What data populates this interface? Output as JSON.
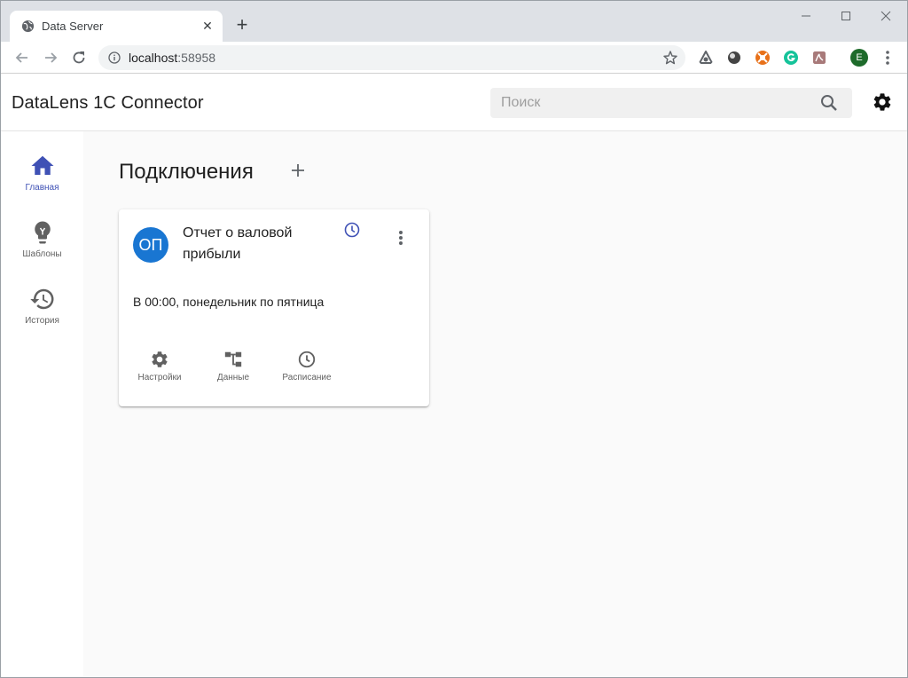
{
  "browser": {
    "tab_title": "Data Server",
    "url_host": "localhost",
    "url_port": ":58958",
    "profile_initial": "E",
    "extensions": [
      {
        "name": "dolphin-ext-icon",
        "color": "#5f6368"
      },
      {
        "name": "circle-ext-icon",
        "color": "#444444"
      },
      {
        "name": "lifesaver-ext-icon",
        "color": "#e8711a"
      },
      {
        "name": "grammarly-ext-icon",
        "color": "#15c39a"
      },
      {
        "name": "pdf-ext-icon",
        "color": "#9e6a6a"
      }
    ]
  },
  "appbar": {
    "title": "DataLens 1C Connector",
    "search_placeholder": "Поиск"
  },
  "sidebar": {
    "items": [
      {
        "label": "Главная",
        "icon": "home-icon"
      },
      {
        "label": "Шаблоны",
        "icon": "lightbulb-icon"
      },
      {
        "label": "История",
        "icon": "history-icon"
      }
    ]
  },
  "main": {
    "title": "Подключения"
  },
  "card": {
    "avatar": "ОП",
    "title": "Отчет о валовой прибыли",
    "description": "В 00:00, понедельник по пятница",
    "actions": [
      {
        "label": "Настройки",
        "icon": "gear-icon"
      },
      {
        "label": "Данные",
        "icon": "data-tree-icon"
      },
      {
        "label": "Расписание",
        "icon": "clock-icon"
      }
    ]
  },
  "colors": {
    "accent": "#3f51b5",
    "avatar": "#1976d2",
    "background": "#fafafa"
  }
}
